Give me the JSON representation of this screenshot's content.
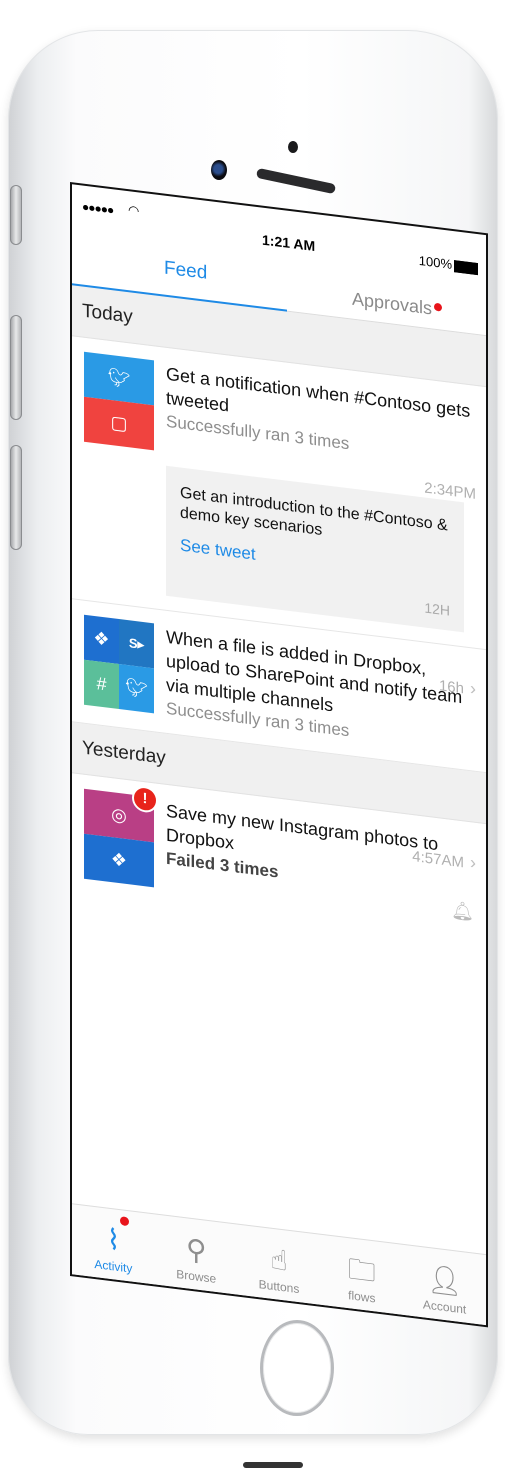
{
  "status_bar": {
    "signal": "●●●●●",
    "wifi": "wifi",
    "time": "1:21 AM",
    "battery": "100%"
  },
  "tabs": [
    {
      "label": "Feed",
      "active": true
    },
    {
      "label": "Approvals",
      "active": false,
      "has_badge": true
    }
  ],
  "sections": [
    {
      "title": "Today"
    },
    {
      "title": "Yesterday"
    }
  ],
  "flows": [
    {
      "title": "Get a notification when #Contoso gets tweeted",
      "status": "Successfully ran 3 times",
      "time": "2:34PM",
      "icons": [
        "twitter-icon",
        "notification-icon"
      ],
      "tweet": {
        "text": "Get an introduction to the #Contoso & demo key scenarios",
        "link": "See tweet",
        "time": "12H"
      }
    },
    {
      "title": "When a file is added in Dropbox, upload to SharePoint and notify team via multiple channels",
      "status": "Successfully ran 3 times",
      "time": "16h",
      "icons": [
        "dropbox-icon",
        "sharepoint-icon",
        "slack-icon",
        "twitter-icon"
      ]
    },
    {
      "title": "Save my new Instagram photos to Dropbox",
      "status": "Failed 3 times",
      "time": "4:57AM",
      "icons": [
        "instagram-icon",
        "dropbox-icon"
      ],
      "error_badge": "!"
    }
  ],
  "tabbar": [
    {
      "label": "Activity",
      "icon": "activity-icon",
      "active": true,
      "has_badge": true
    },
    {
      "label": "Browse",
      "icon": "search-icon"
    },
    {
      "label": "Buttons",
      "icon": "touch-icon"
    },
    {
      "label": "flows",
      "icon": "folder-flow-icon"
    },
    {
      "label": "Account",
      "icon": "user-icon"
    }
  ],
  "colors": {
    "accent": "#1e8ae6",
    "twitter": "#2a9ae5",
    "notification": "#f0433f",
    "dropbox": "#1e6fd0",
    "sharepoint": "#2176c2",
    "slack": "#5bbf9a",
    "instagram": "#b93f85",
    "badge_red": "#e8141b"
  }
}
